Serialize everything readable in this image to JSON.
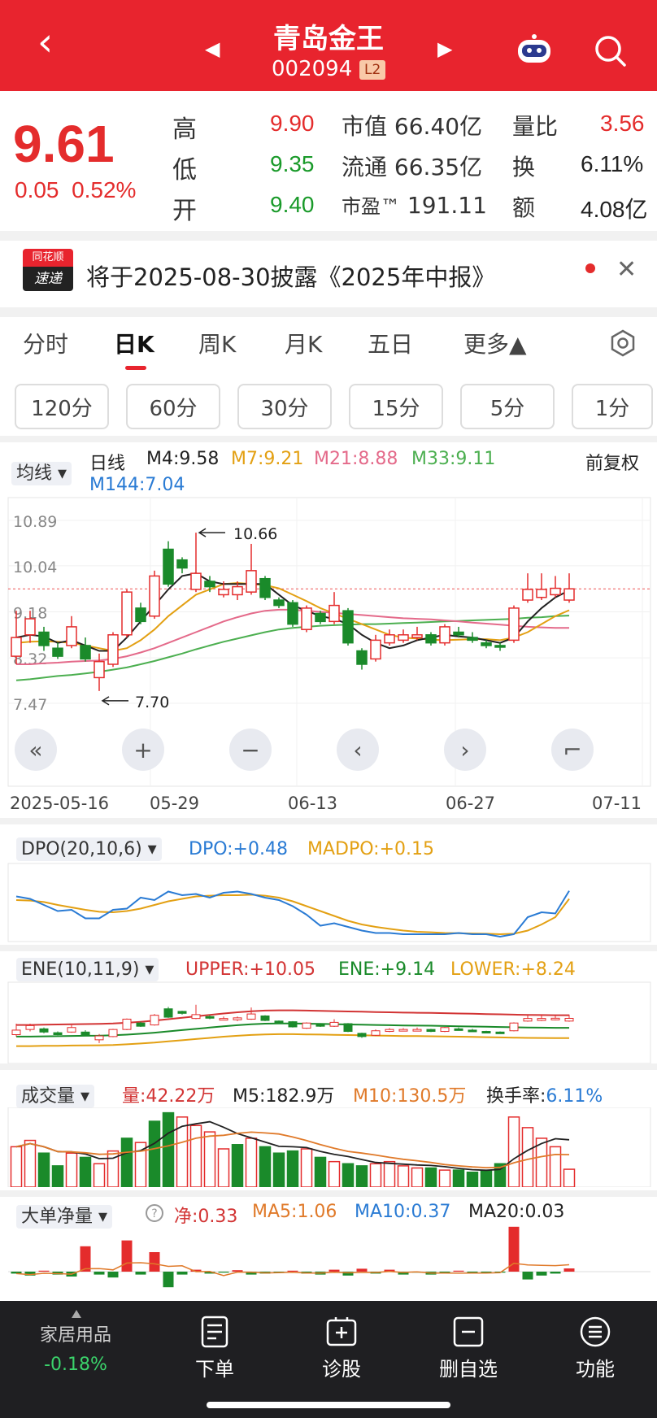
{
  "header": {
    "back_icon": "chevron-left-icon",
    "title": "青岛金王",
    "code": "002094",
    "level_badge": "L2",
    "prev_icon": "triangle-left-icon",
    "next_icon": "triangle-right-icon",
    "robot_icon": "robot-icon",
    "search_icon": "search-icon",
    "bg_color": "#e8242e"
  },
  "quote": {
    "price": "9.61",
    "change": "0.05",
    "change_pct": "0.52%",
    "high_label": "高",
    "high": "9.90",
    "low_label": "低",
    "low": "9.35",
    "open_label": "开",
    "open": "9.40",
    "mcap_label": "市值",
    "mcap": "66.40亿",
    "float_label": "流通",
    "float": "66.35亿",
    "pe_label": "市盈™",
    "pe": "191.11",
    "vol_ratio_label": "量比",
    "vol_ratio": "3.56",
    "turnover_label": "换",
    "turnover": "6.11%",
    "amount_label": "额",
    "amount": "4.08亿"
  },
  "notice": {
    "logo_top": "同花顺",
    "logo_bottom": "速递",
    "text": "将于2025-08-30披露《2025年中报》",
    "close_icon": "close-icon"
  },
  "tabs": [
    "分时",
    "日K",
    "周K",
    "月K",
    "五日",
    "更多▲"
  ],
  "active_tab": "日K",
  "settings_icon": "gear-icon",
  "periods": [
    "120分",
    "60分",
    "30分",
    "15分",
    "5分",
    "1分"
  ],
  "kline": {
    "selector": "均线",
    "line_type": "日线",
    "ma": [
      {
        "label": "M4:9.58",
        "color": "#222222"
      },
      {
        "label": "M7:9.21",
        "color": "#e3a013"
      },
      {
        "label": "M21:8.88",
        "color": "#e46a8a"
      },
      {
        "label": "M33:9.11",
        "color": "#4caf50"
      },
      {
        "label": "M144:7.04",
        "color": "#2a7bd4"
      }
    ],
    "adjust": "前复权",
    "y_ticks": [
      "10.89",
      "10.04",
      "9.18",
      "8.32",
      "7.47"
    ],
    "max_label": "10.66",
    "min_label": "7.70",
    "dates": [
      "2025-05-16",
      "05-29",
      "06-13",
      "06-27",
      "07-11"
    ],
    "up_color": "#e42c2c",
    "down_color": "#1a8a2a"
  },
  "chart_controls": [
    "«",
    "+",
    "−",
    "‹",
    "›",
    "⌐"
  ],
  "dpo": {
    "selector": "DPO(20,10,6)",
    "dpo_label": "DPO:+0.48",
    "madpo_label": "MADPO:+0.15"
  },
  "ene": {
    "selector": "ENE(10,11,9)",
    "upper_label": "UPPER:+10.05",
    "ene_label": "ENE:+9.14",
    "lower_label": "LOWER:+8.24"
  },
  "volume": {
    "selector": "成交量",
    "vol_label": "量:42.22万",
    "m5_label": "M5:182.9万",
    "m10_label": "M10:130.5万",
    "turnover_prefix": "换手率:",
    "turnover_value": "6.11%"
  },
  "bigorder": {
    "selector": "大单净量",
    "help_icon": "help-icon",
    "net_label": "净:0.33",
    "ma5_label": "MA5:1.06",
    "ma10_label": "MA10:0.37",
    "ma20_label": "MA20:0.03"
  },
  "bottom": {
    "sector_name": "家居用品",
    "sector_change": "-0.18%",
    "items": [
      "下单",
      "诊股",
      "删自选",
      "功能"
    ]
  },
  "chart_data": {
    "type": "candlestick",
    "candles": [
      {
        "o": 8.35,
        "c": 8.7,
        "h": 9.2,
        "l": 8.2
      },
      {
        "o": 8.75,
        "c": 9.05,
        "h": 9.2,
        "l": 8.6
      },
      {
        "o": 8.8,
        "c": 8.55,
        "h": 8.9,
        "l": 8.45
      },
      {
        "o": 8.5,
        "c": 8.35,
        "h": 8.6,
        "l": 8.3
      },
      {
        "o": 8.55,
        "c": 8.9,
        "h": 9.1,
        "l": 8.5
      },
      {
        "o": 8.55,
        "c": 8.3,
        "h": 8.7,
        "l": 8.25
      },
      {
        "o": 7.95,
        "c": 8.25,
        "h": 8.4,
        "l": 7.7
      },
      {
        "o": 8.2,
        "c": 8.75,
        "h": 8.8,
        "l": 8.15
      },
      {
        "o": 8.75,
        "c": 9.55,
        "h": 9.6,
        "l": 8.7
      },
      {
        "o": 9.25,
        "c": 9.0,
        "h": 9.35,
        "l": 8.95
      },
      {
        "o": 9.1,
        "c": 9.85,
        "h": 9.95,
        "l": 9.05
      },
      {
        "o": 10.35,
        "c": 9.7,
        "h": 10.5,
        "l": 9.65
      },
      {
        "o": 10.15,
        "c": 10.0,
        "h": 10.2,
        "l": 9.9
      },
      {
        "o": 9.6,
        "c": 9.9,
        "h": 10.66,
        "l": 9.55
      },
      {
        "o": 9.75,
        "c": 9.65,
        "h": 9.85,
        "l": 9.55
      },
      {
        "o": 9.5,
        "c": 9.6,
        "h": 9.75,
        "l": 9.45
      },
      {
        "o": 9.5,
        "c": 9.65,
        "h": 9.75,
        "l": 9.4
      },
      {
        "o": 9.55,
        "c": 9.95,
        "h": 10.45,
        "l": 9.5
      },
      {
        "o": 9.8,
        "c": 9.45,
        "h": 9.85,
        "l": 9.4
      },
      {
        "o": 9.4,
        "c": 9.3,
        "h": 9.45,
        "l": 9.25
      },
      {
        "o": 9.35,
        "c": 8.95,
        "h": 9.4,
        "l": 8.9
      },
      {
        "o": 8.85,
        "c": 9.25,
        "h": 9.3,
        "l": 8.8
      },
      {
        "o": 9.15,
        "c": 9.0,
        "h": 9.2,
        "l": 8.95
      },
      {
        "o": 9.0,
        "c": 9.3,
        "h": 9.55,
        "l": 8.95
      },
      {
        "o": 9.2,
        "c": 8.6,
        "h": 9.25,
        "l": 8.55
      },
      {
        "o": 8.45,
        "c": 8.2,
        "h": 8.5,
        "l": 8.1
      },
      {
        "o": 8.3,
        "c": 8.65,
        "h": 8.75,
        "l": 8.25
      },
      {
        "o": 8.6,
        "c": 8.75,
        "h": 8.85,
        "l": 8.55
      },
      {
        "o": 8.65,
        "c": 8.75,
        "h": 8.85,
        "l": 8.6
      },
      {
        "o": 8.7,
        "c": 8.75,
        "h": 8.9,
        "l": 8.65
      },
      {
        "o": 8.75,
        "c": 8.6,
        "h": 8.8,
        "l": 8.55
      },
      {
        "o": 8.6,
        "c": 8.9,
        "h": 8.95,
        "l": 8.55
      },
      {
        "o": 8.8,
        "c": 8.75,
        "h": 8.9,
        "l": 8.7
      },
      {
        "o": 8.7,
        "c": 8.65,
        "h": 8.8,
        "l": 8.6
      },
      {
        "o": 8.6,
        "c": 8.55,
        "h": 8.65,
        "l": 8.5
      },
      {
        "o": 8.55,
        "c": 8.52,
        "h": 8.6,
        "l": 8.45
      },
      {
        "o": 8.65,
        "c": 9.25,
        "h": 9.3,
        "l": 8.6
      },
      {
        "o": 9.4,
        "c": 9.6,
        "h": 9.9,
        "l": 9.35
      },
      {
        "o": 9.45,
        "c": 9.6,
        "h": 9.9,
        "l": 9.4
      },
      {
        "o": 9.5,
        "c": 9.62,
        "h": 9.85,
        "l": 9.45
      },
      {
        "o": 9.4,
        "c": 9.61,
        "h": 9.9,
        "l": 9.35
      }
    ],
    "ma4": [
      8.7,
      8.75,
      8.72,
      8.6,
      8.65,
      8.55,
      8.45,
      8.45,
      8.7,
      9.0,
      9.3,
      9.6,
      9.85,
      9.9,
      9.75,
      9.7,
      9.7,
      9.7,
      9.7,
      9.5,
      9.3,
      9.2,
      9.1,
      9.05,
      8.95,
      8.75,
      8.6,
      8.5,
      8.55,
      8.65,
      8.7,
      8.75,
      8.72,
      8.7,
      8.65,
      8.6,
      8.7,
      9.0,
      9.25,
      9.45,
      9.58
    ],
    "ma7": [
      8.6,
      8.62,
      8.63,
      8.62,
      8.6,
      8.55,
      8.5,
      8.45,
      8.5,
      8.65,
      8.85,
      9.1,
      9.3,
      9.5,
      9.6,
      9.7,
      9.72,
      9.7,
      9.68,
      9.62,
      9.5,
      9.38,
      9.25,
      9.15,
      9.05,
      8.95,
      8.85,
      8.75,
      8.7,
      8.68,
      8.66,
      8.65,
      8.66,
      8.67,
      8.67,
      8.65,
      8.7,
      8.8,
      8.95,
      9.1,
      9.21
    ],
    "ma21": [
      8.2,
      8.2,
      8.22,
      8.23,
      8.25,
      8.26,
      8.27,
      8.3,
      8.35,
      8.42,
      8.5,
      8.6,
      8.7,
      8.8,
      8.9,
      9.0,
      9.08,
      9.15,
      9.2,
      9.22,
      9.22,
      9.2,
      9.18,
      9.16,
      9.14,
      9.12,
      9.1,
      9.08,
      9.06,
      9.05,
      9.04,
      9.02,
      9.0,
      8.98,
      8.96,
      8.94,
      8.92,
      8.9,
      8.89,
      8.88,
      8.88
    ],
    "ma33": [
      7.9,
      7.92,
      7.95,
      7.98,
      8.0,
      8.03,
      8.06,
      8.1,
      8.14,
      8.2,
      8.26,
      8.33,
      8.4,
      8.48,
      8.55,
      8.62,
      8.68,
      8.74,
      8.8,
      8.85,
      8.88,
      8.9,
      8.92,
      8.93,
      8.94,
      8.95,
      8.95,
      8.96,
      8.97,
      8.98,
      8.99,
      9.0,
      9.01,
      9.02,
      9.03,
      9.04,
      9.05,
      9.07,
      9.08,
      9.1,
      9.11
    ],
    "y_range": [
      7.47,
      10.89
    ],
    "dpo": [
      0.25,
      0.15,
      -0.1,
      -0.35,
      -0.3,
      -0.65,
      -0.65,
      -0.3,
      -0.25,
      0.2,
      0.1,
      0.45,
      0.3,
      0.35,
      0.2,
      0.4,
      0.45,
      0.35,
      0.2,
      0.1,
      -0.15,
      -0.5,
      -0.95,
      -0.85,
      -1.0,
      -1.15,
      -1.25,
      -1.25,
      -1.3,
      -1.3,
      -1.3,
      -1.3,
      -1.25,
      -1.3,
      -1.3,
      -1.4,
      -1.3,
      -0.6,
      -0.4,
      -0.45,
      0.48
    ],
    "madpo": [
      0.1,
      0.08,
      0.02,
      -0.1,
      -0.2,
      -0.3,
      -0.38,
      -0.4,
      -0.35,
      -0.25,
      -0.1,
      0.05,
      0.15,
      0.25,
      0.28,
      0.3,
      0.3,
      0.32,
      0.28,
      0.2,
      0.05,
      -0.15,
      -0.35,
      -0.55,
      -0.75,
      -0.9,
      -1.0,
      -1.08,
      -1.15,
      -1.2,
      -1.22,
      -1.25,
      -1.26,
      -1.27,
      -1.28,
      -1.3,
      -1.28,
      -1.15,
      -0.9,
      -0.6,
      0.15
    ],
    "volume": [
      95,
      110,
      80,
      50,
      80,
      70,
      55,
      85,
      115,
      105,
      155,
      175,
      165,
      145,
      130,
      90,
      100,
      115,
      95,
      80,
      85,
      90,
      70,
      60,
      55,
      50,
      55,
      60,
      50,
      45,
      45,
      40,
      40,
      35,
      38,
      55,
      165,
      140,
      115,
      95,
      42
    ],
    "volume_down": [
      false,
      false,
      true,
      true,
      false,
      true,
      false,
      false,
      true,
      false,
      true,
      true,
      false,
      false,
      false,
      false,
      true,
      false,
      true,
      true,
      true,
      false,
      true,
      false,
      true,
      true,
      false,
      false,
      false,
      false,
      true,
      false,
      true,
      true,
      true,
      true,
      false,
      false,
      false,
      false,
      false
    ],
    "bigorder": [
      -0.2,
      -0.4,
      0.1,
      -0.3,
      -0.5,
      2.6,
      -0.3,
      -0.6,
      3.2,
      -0.3,
      2.0,
      -1.6,
      -0.3,
      0.2,
      -0.2,
      -0.1,
      0.15,
      -0.3,
      -0.2,
      -0.1,
      0.1,
      -0.2,
      -0.3,
      0.2,
      -0.4,
      0.3,
      -0.2,
      0.2,
      -0.3,
      -0.1,
      -0.3,
      -0.2,
      0.1,
      -0.2,
      -0.1,
      -0.1,
      4.6,
      -0.8,
      -0.4,
      -0.2,
      0.33
    ]
  }
}
